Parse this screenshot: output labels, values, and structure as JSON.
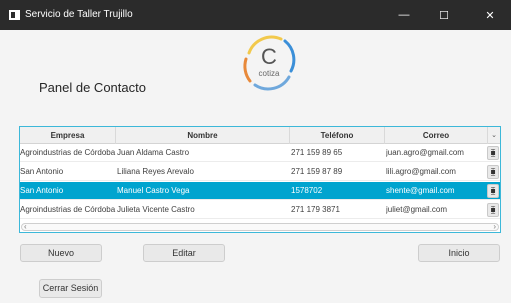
{
  "window": {
    "title": "Servicio de Taller Trujillo",
    "controls": {
      "minimize": "—",
      "maximize": "☐",
      "close": "✕"
    }
  },
  "panel": {
    "title": "Panel de Contacto"
  },
  "logo": {
    "text": "cotiza",
    "letter": "C",
    "colors": [
      "#f2c94c",
      "#3b8fd8",
      "#e8893a",
      "#6fa8dc"
    ]
  },
  "table": {
    "columns": [
      "Empresa",
      "Nombre",
      "Teléfono",
      "Correo"
    ],
    "sort_indicator": "⌄",
    "selected_row": 2,
    "row_button_icon": "trash-icon",
    "row_button_glyph": "⧯",
    "rows": [
      {
        "empresa": "Agroindustrias de Córdoba",
        "nombre": "Juan  Aldama Castro",
        "telefono": "271 159 89 65",
        "correo": "juan.agro@gmail.com"
      },
      {
        "empresa": "San Antonio",
        "nombre": "Liliana Reyes Arevalo",
        "telefono": "271 159 87 89",
        "correo": "lili.agro@gmail.com"
      },
      {
        "empresa": "San Antonio",
        "nombre": "Manuel Castro Vega",
        "telefono": "1578702",
        "correo": "shente@gmail.com"
      },
      {
        "empresa": "Agroindustrias de Córdoba",
        "nombre": "Julieta  Vicente Castro",
        "telefono": "271 179 3871",
        "correo": "juliet@gmail.com"
      }
    ],
    "scroll": {
      "left": "‹",
      "right": "›"
    }
  },
  "buttons": {
    "nuevo": "Nuevo",
    "editar": "Editar",
    "inicio": "Inicio",
    "cerrar_sesion": "Cerrar Sesión"
  }
}
